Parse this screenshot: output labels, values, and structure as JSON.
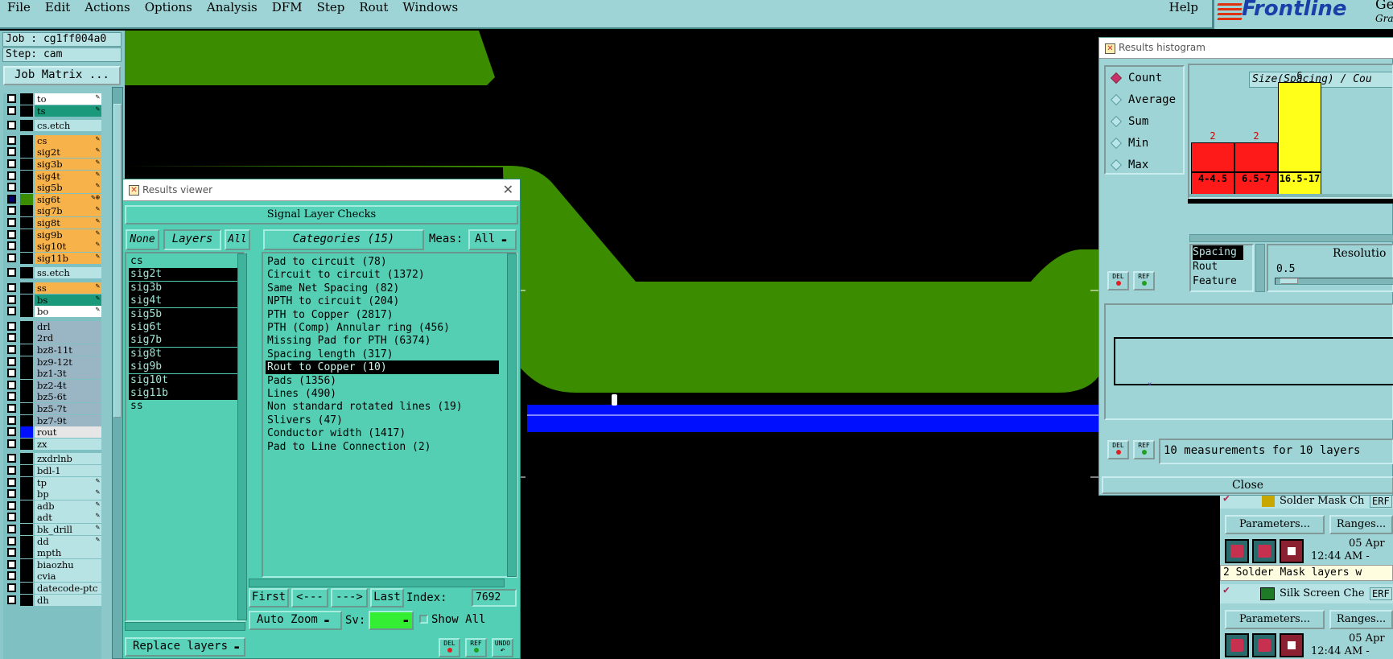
{
  "menubar": {
    "items": [
      "File",
      "Edit",
      "Actions",
      "Options",
      "Analysis",
      "DFM",
      "Step",
      "Rout",
      "Windows"
    ],
    "help": "Help"
  },
  "logo": {
    "brand": "Frontline",
    "text_partial": "Gene",
    "subtitle_partial": "Grap"
  },
  "job": {
    "job_label": "Job : cg1ff004a0",
    "step_label": "Step: cam",
    "matrix_button": "Job Matrix ..."
  },
  "layers": [
    {
      "name": "to",
      "color": "#ffffff",
      "checked": false,
      "mark": "✎"
    },
    {
      "name": "ts",
      "color": "#1a9a7a",
      "checked": false,
      "mark": "✎"
    },
    {
      "name": "cs.etch",
      "color": "#b7e3e4",
      "checked": false,
      "mark": ""
    },
    {
      "name": "cs",
      "color": "#f8b24a",
      "checked": false,
      "mark": "✎"
    },
    {
      "name": "sig2t",
      "color": "#f8b24a",
      "checked": false,
      "mark": "✎"
    },
    {
      "name": "sig3b",
      "color": "#f8b24a",
      "checked": false,
      "mark": "✎"
    },
    {
      "name": "sig4t",
      "color": "#f8b24a",
      "checked": false,
      "mark": "✎"
    },
    {
      "name": "sig5b",
      "color": "#f8b24a",
      "checked": false,
      "mark": "✎"
    },
    {
      "name": "sig6t",
      "color": "#f8b24a",
      "checked": true,
      "mark": "✎⊕"
    },
    {
      "name": "sig7b",
      "color": "#f8b24a",
      "checked": false,
      "mark": "✎"
    },
    {
      "name": "sig8t",
      "color": "#f8b24a",
      "checked": false,
      "mark": "✎"
    },
    {
      "name": "sig9b",
      "color": "#f8b24a",
      "checked": false,
      "mark": "✎"
    },
    {
      "name": "sig10t",
      "color": "#f8b24a",
      "checked": false,
      "mark": "✎"
    },
    {
      "name": "sig11b",
      "color": "#f8b24a",
      "checked": false,
      "mark": "✎"
    },
    {
      "name": "ss.etch",
      "color": "#b7e3e4",
      "checked": false,
      "mark": ""
    },
    {
      "name": "ss",
      "color": "#f8b24a",
      "checked": false,
      "mark": "✎"
    },
    {
      "name": "bs",
      "color": "#1a9a7a",
      "checked": false,
      "mark": "✎"
    },
    {
      "name": "bo",
      "color": "#ffffff",
      "checked": false,
      "mark": "✎"
    },
    {
      "name": "drl",
      "color": "#9ab6c4",
      "checked": false,
      "mark": ""
    },
    {
      "name": "2rd",
      "color": "#9ab6c4",
      "checked": false,
      "mark": ""
    },
    {
      "name": "bz8-11t",
      "color": "#9ab6c4",
      "checked": false,
      "mark": ""
    },
    {
      "name": "bz9-12t",
      "color": "#9ab6c4",
      "checked": false,
      "mark": ""
    },
    {
      "name": "bz1-3t",
      "color": "#9ab6c4",
      "checked": false,
      "mark": ""
    },
    {
      "name": "bz2-4t",
      "color": "#9ab6c4",
      "checked": false,
      "mark": ""
    },
    {
      "name": "bz5-6t",
      "color": "#9ab6c4",
      "checked": false,
      "mark": ""
    },
    {
      "name": "bz5-7t",
      "color": "#9ab6c4",
      "checked": false,
      "mark": ""
    },
    {
      "name": "bz7-9t",
      "color": "#9ab6c4",
      "checked": false,
      "mark": ""
    },
    {
      "name": "rout",
      "color": "#e6e6e6",
      "checked": false,
      "mark": ""
    },
    {
      "name": "zx",
      "color": "#b7e3e4",
      "checked": false,
      "mark": ""
    },
    {
      "name": "zxdrlnb",
      "color": "#b7e3e4",
      "checked": false,
      "mark": ""
    },
    {
      "name": "bdl-1",
      "color": "#b7e3e4",
      "checked": false,
      "mark": ""
    },
    {
      "name": "tp",
      "color": "#b7e3e4",
      "checked": false,
      "mark": "✎"
    },
    {
      "name": "bp",
      "color": "#b7e3e4",
      "checked": false,
      "mark": "✎"
    },
    {
      "name": "adb",
      "color": "#b7e3e4",
      "checked": false,
      "mark": "✎"
    },
    {
      "name": "adt",
      "color": "#b7e3e4",
      "checked": false,
      "mark": "✎"
    },
    {
      "name": "bk_drill",
      "color": "#b7e3e4",
      "checked": false,
      "mark": "✎"
    },
    {
      "name": "dd",
      "color": "#b7e3e4",
      "checked": false,
      "mark": "✎"
    },
    {
      "name": "mpth",
      "color": "#b7e3e4",
      "checked": false,
      "mark": ""
    },
    {
      "name": "biaozhu",
      "color": "#b7e3e4",
      "checked": false,
      "mark": ""
    },
    {
      "name": "cvia",
      "color": "#b7e3e4",
      "checked": false,
      "mark": ""
    },
    {
      "name": "datecode-ptc",
      "color": "#b7e3e4",
      "checked": false,
      "mark": ""
    },
    {
      "name": "dh",
      "color": "#b7e3e4",
      "checked": false,
      "mark": ""
    }
  ],
  "results_viewer": {
    "title": "Results viewer",
    "header": "Signal Layer Checks",
    "none_btn": "None",
    "layers_btn": "Layers",
    "all_btn": "All",
    "categories_btn": "Categories (15)",
    "meas_label": "Meas:",
    "meas_value": "All",
    "layer_items": [
      "cs",
      "sig2t",
      "sig3b",
      "sig4t",
      "sig5b",
      "sig6t",
      "sig7b",
      "sig8t",
      "sig9b",
      "sig10t",
      "sig11b",
      "ss"
    ],
    "categories": [
      "Pad to circuit (78)",
      "Circuit to circuit (1372)",
      "Same Net Spacing (82)",
      "NPTH to circuit (204)",
      "PTH to Copper (2817)",
      "PTH (Comp) Annular ring (456)",
      "Missing Pad for PTH (6374)",
      "Spacing length (317)",
      "Rout to Copper (10)",
      "Pads (1356)",
      "Lines (490)",
      "Non standard rotated lines (19)",
      "Slivers (47)",
      "Conductor width (1417)",
      "Pad to Line Connection (2)"
    ],
    "selected_category": 8,
    "first_btn": "First",
    "prev_btn": "<---",
    "next_btn": "--->",
    "last_btn": "Last",
    "index_label": "Index:",
    "index_value": "7692",
    "autozoom": "Auto Zoom",
    "sv_label": "Sv:",
    "show_all": "Show All",
    "replace_layers": "Replace layers",
    "del_label": "DEL",
    "ref_label": "REF",
    "undo_label": "UNDO"
  },
  "histogram": {
    "title": "Results histogram",
    "modes": [
      "Count",
      "Average",
      "Sum",
      "Min",
      "Max"
    ],
    "selected_mode": "Count",
    "chart_title_partial": "Size(Spacing) / Cou",
    "options": [
      "Spacing",
      "Rout",
      "Feature"
    ],
    "resolution_label": "Resolutio",
    "resolution_value": "0.5",
    "summary": "10 measurements for 10 layers",
    "close_btn": "Close",
    "del_label": "DEL",
    "ref_label": "REF"
  },
  "chart_data": {
    "type": "bar",
    "categories": [
      "4-4.5",
      "6.5-7",
      "16.5-17"
    ],
    "values": [
      2,
      2,
      6
    ],
    "colors": [
      "#ff1a1a",
      "#ff1a1a",
      "#ffff1a"
    ],
    "ylim": [
      0,
      6
    ]
  },
  "right_panel": {
    "solder_mask": "Solder Mask Ch",
    "silk_screen": "Silk Screen Che",
    "erf": "ERF",
    "parameters": "Parameters...",
    "ranges": "Ranges...",
    "date": "05 Apr",
    "time": "12:44 AM -",
    "solder_msg": "2 Solder Mask layers w"
  },
  "colors": {
    "panel": "#9fd4d6",
    "viewer": "#53cfb5",
    "copper": "#3c8c00",
    "rout": "#0010ff"
  }
}
